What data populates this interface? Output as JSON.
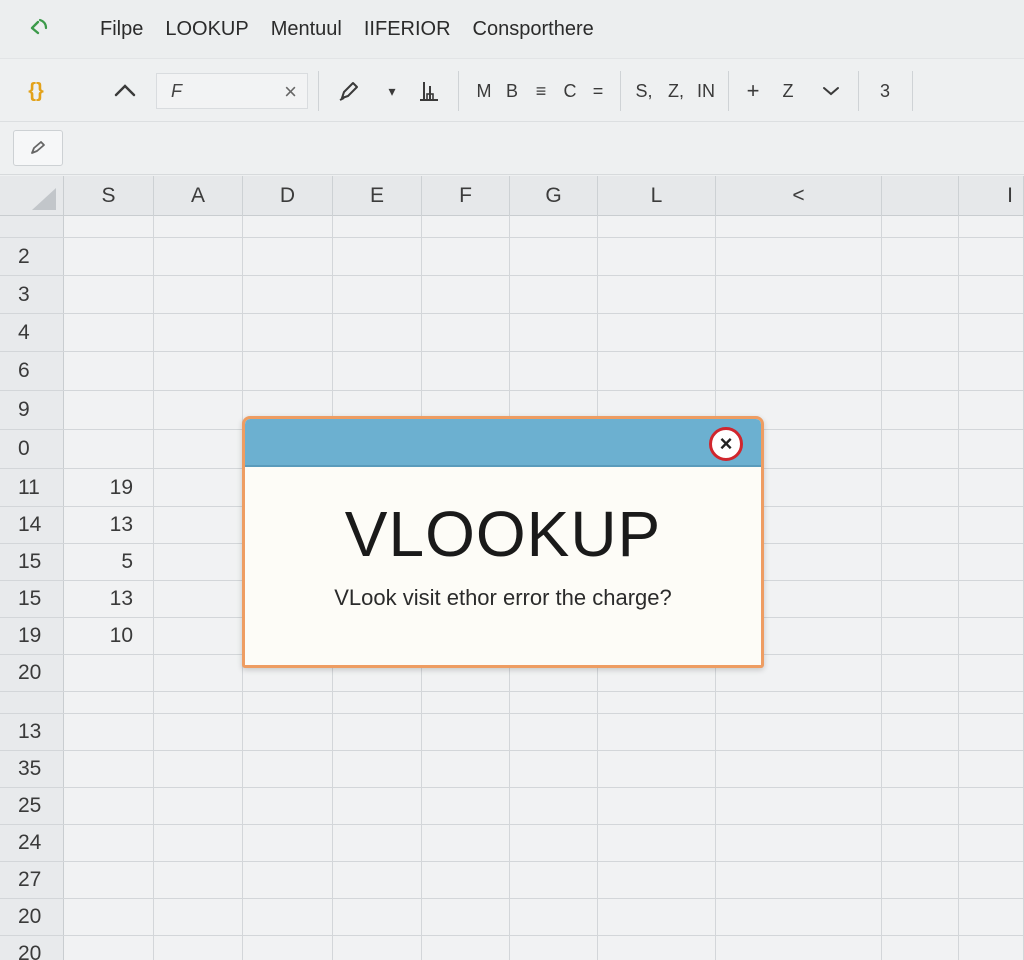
{
  "menubar": {
    "logo_icon": "refresh-arrow-icon",
    "items": [
      "Filpe",
      "LOOKUP",
      "Mentuul",
      "IIFERIOR",
      "Consporthere"
    ]
  },
  "toolbar": {
    "brace_icon": "{}",
    "collapse_icon": "chevron-up-icon",
    "font_value": "F",
    "clear_glyph": "×",
    "paint_icon": "pen-icon",
    "dropdown_glyph": "▾",
    "chart_glyph": "╟",
    "text_buttons": [
      "M",
      "B",
      "≡",
      "C",
      "="
    ],
    "format_buttons": [
      "S,",
      "Z,",
      "IN"
    ],
    "plus_glyph": "+",
    "z_label": "Z",
    "chevron_down_glyph": "⌄",
    "count_label": "3"
  },
  "formulabar": {
    "fx_icon": "pen-icon"
  },
  "grid": {
    "column_headers": [
      "S",
      "A",
      "D",
      "E",
      "F",
      "G",
      "L",
      "<",
      "",
      "I"
    ],
    "rows": [
      {
        "label": "",
        "value": ""
      },
      {
        "label": "2",
        "value": ""
      },
      {
        "label": "3",
        "value": ""
      },
      {
        "label": "4",
        "value": ""
      },
      {
        "label": "6",
        "value": ""
      },
      {
        "label": "9",
        "value": ""
      },
      {
        "label": "0",
        "value": ""
      },
      {
        "label": "11",
        "value": "19"
      },
      {
        "label": "14",
        "value": "13"
      },
      {
        "label": "15",
        "value": "5"
      },
      {
        "label": "15",
        "value": "13"
      },
      {
        "label": "19",
        "value": "10"
      },
      {
        "label": "20",
        "value": ""
      },
      {
        "label": "",
        "value": ""
      },
      {
        "label": "13",
        "value": ""
      },
      {
        "label": "35",
        "value": ""
      },
      {
        "label": "25",
        "value": ""
      },
      {
        "label": "24",
        "value": ""
      },
      {
        "label": "27",
        "value": ""
      },
      {
        "label": "20",
        "value": ""
      },
      {
        "label": "20",
        "value": ""
      }
    ]
  },
  "dialog": {
    "heading": "VLOOKUP",
    "message": "VLook visit ethor error the charge?",
    "close_glyph": "×",
    "colors": {
      "titlebar": "#6cb0d0",
      "border": "#ee9d62",
      "close_ring": "#d0262e",
      "body": "#fdfcf7"
    }
  }
}
